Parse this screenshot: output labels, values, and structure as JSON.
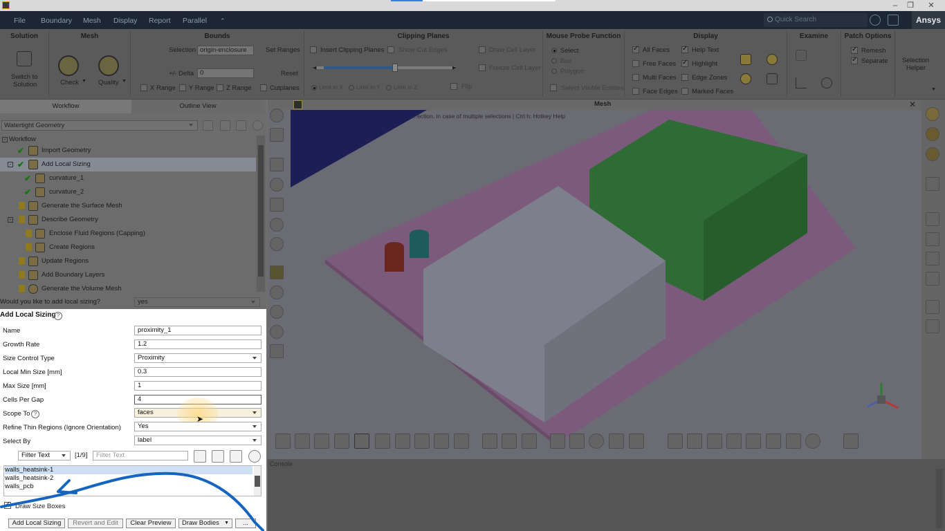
{
  "menu": [
    "File",
    "Boundary",
    "Mesh",
    "Display",
    "Report",
    "Parallel"
  ],
  "quick_search_placeholder": "Quick Search",
  "brand": "Ansys",
  "ribbon": {
    "solution": {
      "title": "Solution",
      "switch_label_1": "Switch to",
      "switch_label_2": "Solution"
    },
    "mesh": {
      "title": "Mesh",
      "check": "Check",
      "quality": "Quality"
    },
    "bounds": {
      "title": "Bounds",
      "selection_label": "Selection",
      "selection_value": "origin-enclosure",
      "set_ranges": "Set Ranges",
      "delta_label": "+/- Delta",
      "delta_value": "0",
      "reset": "Reset",
      "x_range": "X Range",
      "y_range": "Y Range",
      "z_range": "Z Range",
      "cutplanes": "Cutplanes"
    },
    "clipping": {
      "title": "Clipping Planes",
      "insert": "Insert Clipping Planes",
      "show_cut_edges": "Show Cut Edges",
      "draw_cell_layer": "Draw Cell Layer",
      "freeze_cell_layer": "Freeze Cell Layer",
      "limit_x": "Limit in X",
      "limit_y": "Limit in Y",
      "limit_z": "Limit in Z",
      "flip": "Flip"
    },
    "probe": {
      "title": "Mouse Probe Function",
      "select": "Select",
      "box": "Box",
      "polygon": "Polygon",
      "select_visible": "Select Visible Entities"
    },
    "display": {
      "title": "Display",
      "all_faces": "All Faces",
      "free_faces": "Free Faces",
      "multi_faces": "Multi Faces",
      "face_edges": "Face Edges",
      "help_text": "Help Text",
      "highlight": "Highlight",
      "edge_zones": "Edge Zones",
      "marked_faces": "Marked Faces"
    },
    "examine": {
      "title": "Examine"
    },
    "patch": {
      "title": "Patch Options",
      "remesh": "Remesh",
      "separate": "Separate"
    },
    "selection_helper_1": "Selection",
    "selection_helper_2": "Helper"
  },
  "left": {
    "tabs": [
      "Workflow",
      "Outline View"
    ],
    "workflow_type": "Watertight Geometry",
    "tree": [
      {
        "label": "Workflow"
      },
      {
        "label": "Import Geometry"
      },
      {
        "label": "Add Local Sizing"
      },
      {
        "label": "curvature_1"
      },
      {
        "label": "curvature_2"
      },
      {
        "label": "Generate the Surface Mesh"
      },
      {
        "label": "Describe Geometry"
      },
      {
        "label": "Enclose Fluid Regions (Capping)"
      },
      {
        "label": "Create Regions"
      },
      {
        "label": "Update Regions"
      },
      {
        "label": "Add Boundary Layers"
      },
      {
        "label": "Generate the Volume Mesh"
      }
    ],
    "question": "Would you like to add local sizing?",
    "question_answer": "yes"
  },
  "form": {
    "title": "Add Local Sizing",
    "fields": [
      {
        "label": "Name",
        "value": "proximity_1"
      },
      {
        "label": "Growth Rate",
        "value": "1.2"
      },
      {
        "label": "Size Control Type",
        "value": "Proximity"
      },
      {
        "label": "Local Min Size [mm]",
        "value": "0.3"
      },
      {
        "label": "Max Size [mm]",
        "value": "1"
      },
      {
        "label": "Cells Per Gap",
        "value": "4"
      },
      {
        "label": "Scope To",
        "value": "faces"
      },
      {
        "label": "Refine Thin Regions (Ignore Orientation)",
        "value": "Yes"
      },
      {
        "label": "Select By",
        "value": "label"
      }
    ],
    "filter_mode": "Filter Text",
    "filter_count": "[1/9]",
    "filter_placeholder": "Filter Text",
    "list_items": [
      "walls_heatsink-1",
      "walls_heatsink-2",
      "walls_pcb"
    ],
    "draw_size_boxes": "Draw Size Boxes",
    "buttons": [
      "Add Local Sizing",
      "Revert and Edit",
      "Clear Preview",
      "Draw Bodies",
      "..."
    ]
  },
  "viewport": {
    "title": "Mesh",
    "hint": "...ection, in case of multiple selections | Ctrl h: Hotkey Help"
  },
  "console_title": "Console",
  "colors": {
    "menubar": "#1c2733",
    "annotation": "#1565c0",
    "form_bg": "#ffffff"
  }
}
